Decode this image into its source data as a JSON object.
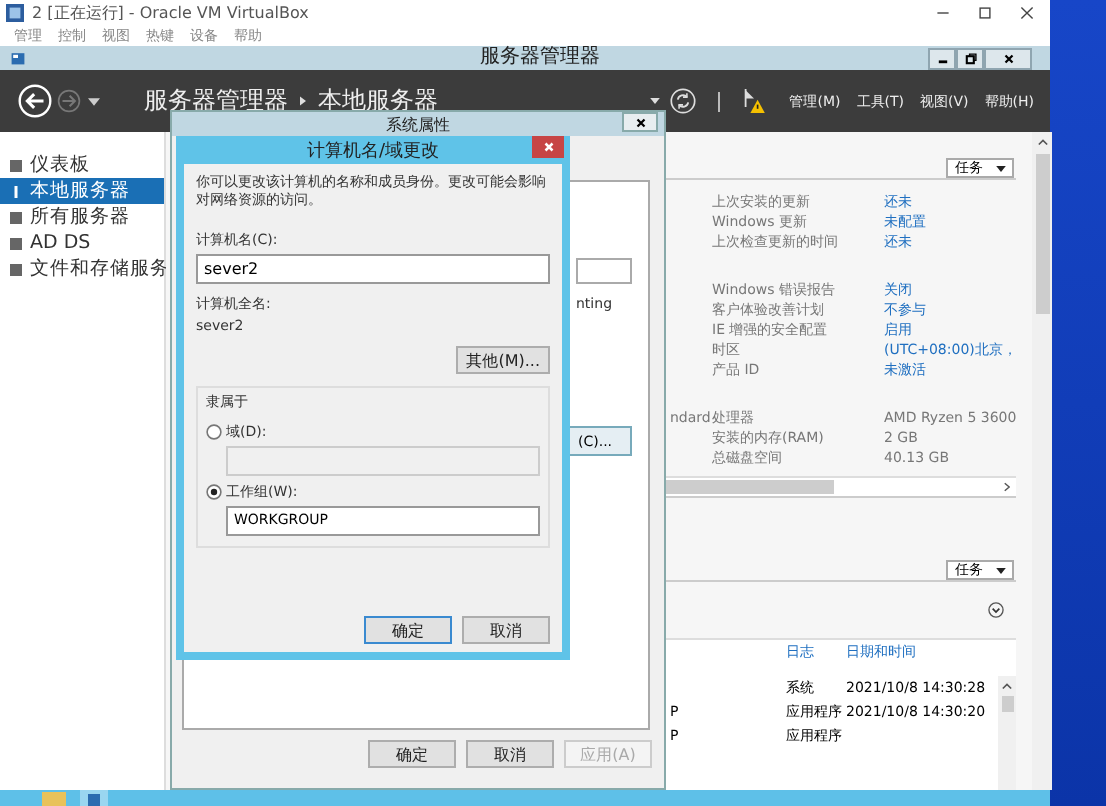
{
  "host_window": {
    "title": "2 [正在运行] - Oracle VM VirtualBox",
    "menu": [
      "管理",
      "控制",
      "视图",
      "热键",
      "设备",
      "帮助"
    ]
  },
  "server_manager": {
    "title": "服务器管理器",
    "breadcrumb": [
      "服务器管理器",
      "本地服务器"
    ],
    "menus": [
      "管理(M)",
      "工具(T)",
      "视图(V)",
      "帮助(H)"
    ]
  },
  "sidebar": [
    {
      "label": "仪表板",
      "selected": false
    },
    {
      "label": "本地服务器",
      "selected": true
    },
    {
      "label": "所有服务器",
      "selected": false
    },
    {
      "label": "AD DS",
      "selected": false
    },
    {
      "label": "文件和存储服务",
      "selected": false
    }
  ],
  "properties": {
    "tasks_button": "任务",
    "rows": [
      {
        "label": "上次安装的更新",
        "value": "还未",
        "kind": "link"
      },
      {
        "label": "Windows 更新",
        "value": "未配置",
        "kind": "link"
      },
      {
        "label": "上次检查更新的时间",
        "value": "还未",
        "kind": "link",
        "gap_after": true
      },
      {
        "label": "Windows 错误报告",
        "value": "关闭",
        "kind": "link"
      },
      {
        "label": "客户体验改善计划",
        "value": "不参与",
        "kind": "link"
      },
      {
        "label": "IE 增强的安全配置",
        "value": "启用",
        "kind": "link"
      },
      {
        "label": "时区",
        "value": "(UTC+08:00)北京，",
        "kind": "link"
      },
      {
        "label": "产品 ID",
        "value": "未激活",
        "kind": "link",
        "gap_after": true
      },
      {
        "column_1": "ndard",
        "label": "处理器",
        "value": "AMD Ryzen 5 3600",
        "kind": "text"
      },
      {
        "label": "安装的内存(RAM)",
        "value": "2 GB",
        "kind": "text"
      },
      {
        "label": "总磁盘空间",
        "value": "40.13 GB",
        "kind": "text"
      }
    ]
  },
  "events": {
    "tasks_button": "任务",
    "columns": [
      "日志",
      "日期和时间"
    ],
    "rows": [
      {
        "log": "系统",
        "time": "2021/10/8 14:30:28"
      },
      {
        "column_1": "P",
        "log": "应用程序",
        "time": "2021/10/8 14:30:20"
      },
      {
        "column_1": "P",
        "log": "应用程序"
      }
    ]
  },
  "system_properties": {
    "title": "系统属性",
    "partial_text": "nting",
    "change_button": "(C)...",
    "buttons": [
      {
        "label": "确定",
        "disabled": false
      },
      {
        "label": "取消",
        "disabled": false
      },
      {
        "label": "应用(A)",
        "disabled": true
      }
    ]
  },
  "computer_name_dialog": {
    "title": "计算机名/域更改",
    "description": "你可以更改该计算机的名称和成员身份。更改可能会影响对网络资源的访问。",
    "name_label": "计算机名(C):",
    "name_value": "sever2",
    "full_name_label": "计算机全名:",
    "full_name": "sever2",
    "more_button": "其他(M)...",
    "member_of": "隶属于",
    "options": [
      {
        "label": "域(D):",
        "selected": false
      },
      {
        "label": "工作组(W):",
        "selected": true,
        "value_field": "WORKGROUP"
      }
    ],
    "buttons": [
      "确定",
      "取消"
    ]
  }
}
